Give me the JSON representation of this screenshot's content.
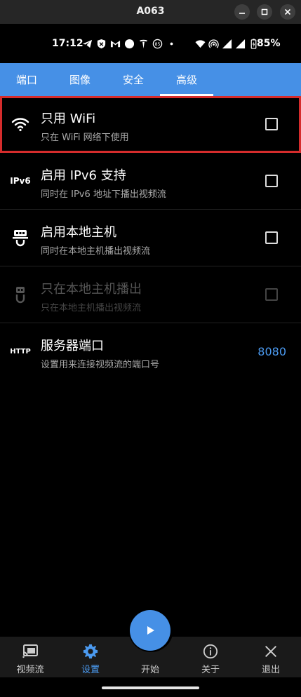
{
  "window": {
    "title": "A063"
  },
  "statusbar": {
    "time": "17:12",
    "battery": "85%"
  },
  "tabs": [
    {
      "label": "端口",
      "active": false
    },
    {
      "label": "图像",
      "active": false
    },
    {
      "label": "安全",
      "active": false
    },
    {
      "label": "高级",
      "active": true
    }
  ],
  "settings": [
    {
      "icon": "wifi-icon",
      "title": "只用 WiFi",
      "subtitle": "只在 WiFi 网络下使用",
      "checked": false,
      "enabled": true
    },
    {
      "icon": "ipv6-icon",
      "icon_text": "IPv6",
      "title": "启用 IPv6 支持",
      "subtitle": "同时在 IPv6 地址下播出视频流",
      "checked": false,
      "enabled": true
    },
    {
      "icon": "localhost-icon",
      "title": "启用本地主机",
      "subtitle": "同时在本地主机播出视频流",
      "checked": false,
      "enabled": true
    },
    {
      "icon": "localhost-only-icon",
      "title": "只在本地主机播出",
      "subtitle": "只在本地主机播出视频流",
      "checked": false,
      "enabled": false
    },
    {
      "icon": "http-icon",
      "icon_text": "HTTP",
      "title": "服务器端口",
      "subtitle": "设置用来连接视频流的端口号",
      "value": "8080",
      "enabled": true
    }
  ],
  "bottomnav": [
    {
      "icon": "cast-icon",
      "label": "视频流",
      "active": false
    },
    {
      "icon": "gear-icon",
      "label": "设置",
      "active": true
    },
    {
      "icon": "play-icon",
      "label": "开始",
      "active": false
    },
    {
      "icon": "info-icon",
      "label": "关于",
      "active": false
    },
    {
      "icon": "close-icon",
      "label": "退出",
      "active": false
    }
  ],
  "colors": {
    "accent": "#4690e6",
    "highlight": "#d52c2c",
    "value": "#4b9af0"
  }
}
